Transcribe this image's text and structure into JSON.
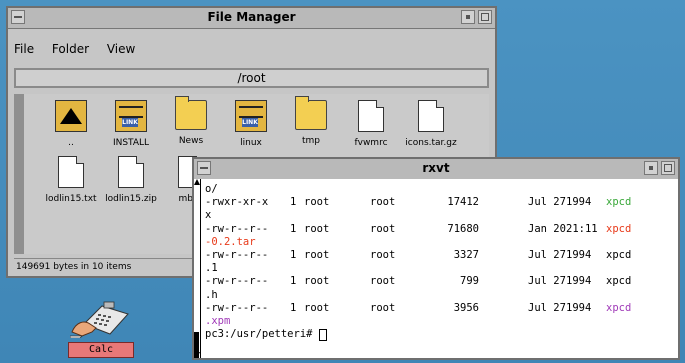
{
  "file_manager": {
    "title": "File Manager",
    "menu": [
      "File",
      "Folder",
      "View"
    ],
    "path": "/root",
    "items_row1": [
      {
        "label": "..",
        "icon": "parent-dir-icon",
        "kind": "up"
      },
      {
        "label": "INSTALL",
        "icon": "link-icon",
        "kind": "link",
        "badge": "LINK"
      },
      {
        "label": "News",
        "icon": "folder-icon",
        "kind": "folder"
      },
      {
        "label": "linux",
        "icon": "link-icon",
        "kind": "link",
        "badge": "LINK"
      },
      {
        "label": "tmp",
        "icon": "folder-icon",
        "kind": "folder"
      },
      {
        "label": "fvwmrc",
        "icon": "document-icon",
        "kind": "doc"
      },
      {
        "label": "icons.tar.gz",
        "icon": "document-icon",
        "kind": "doc"
      }
    ],
    "items_row2": [
      {
        "label": "lodlin15.txt",
        "icon": "document-icon",
        "kind": "doc"
      },
      {
        "label": "lodlin15.zip",
        "icon": "document-icon",
        "kind": "doc"
      },
      {
        "label": "mbox",
        "icon": "document-icon",
        "kind": "doc"
      }
    ],
    "status": "149691 bytes in 10 items"
  },
  "calc": {
    "label": "Calc",
    "icon": "calculator-hand-icon"
  },
  "rxvt": {
    "title": "rxvt",
    "lines": [
      {
        "type": "text",
        "text": "o/"
      },
      {
        "type": "entry",
        "perms": "-rwxr-xr-x",
        "links": "1",
        "owner": "root",
        "group": "root",
        "size": "17412",
        "date": "Jul 27",
        "time": "1994",
        "name": "xpcd",
        "name_color": "#3aa83a"
      },
      {
        "type": "text",
        "text": "x"
      },
      {
        "type": "entry",
        "perms": "-rw-r--r--",
        "links": "1",
        "owner": "root",
        "group": "root",
        "size": "71680",
        "date": "Jan 20",
        "time": "21:11",
        "name": "xpcd",
        "name_color": "#e83a1a"
      },
      {
        "type": "text",
        "text": "-0.2.tar",
        "color": "#e83a1a"
      },
      {
        "type": "entry",
        "perms": "-rw-r--r--",
        "links": "1",
        "owner": "root",
        "group": "root",
        "size": "3327",
        "date": "Jul 27",
        "time": "1994",
        "name": "xpcd",
        "name_color": "#000000"
      },
      {
        "type": "text",
        "text": ".1"
      },
      {
        "type": "entry",
        "perms": "-rw-r--r--",
        "links": "1",
        "owner": "root",
        "group": "root",
        "size": "799",
        "date": "Jul 27",
        "time": "1994",
        "name": "xpcd",
        "name_color": "#000000"
      },
      {
        "type": "text",
        "text": ".h"
      },
      {
        "type": "entry",
        "perms": "-rw-r--r--",
        "links": "1",
        "owner": "root",
        "group": "root",
        "size": "3956",
        "date": "Jul 27",
        "time": "1994",
        "name": "xpcd",
        "name_color": "#a03ab8"
      },
      {
        "type": "text",
        "text": ".xpm",
        "color": "#a03ab8"
      },
      {
        "type": "prompt",
        "text": "pc3:/usr/petteri# "
      }
    ]
  }
}
